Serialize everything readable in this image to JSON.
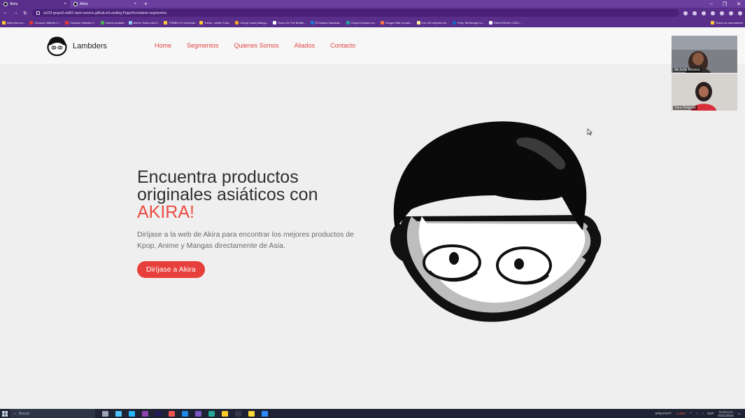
{
  "browser": {
    "tabs": [
      {
        "label": "Akira",
        "active": true
      },
      {
        "label": "Akira",
        "active": false
      }
    ],
    "url": "ai129-grupo2-wd52-open-source.github.io/Landing-Page/#container-segmentos",
    "bookmarks": [
      "https://es.mo...",
      "Corazon Valiente C...",
      "Corazon Valiente C...",
      "Nueva pestaña",
      "Anime Toriko sub E...",
      "TORBO 37 excelente",
      "Toriko - anime Torik...",
      "Candy Candy Manga...",
      "Tosos De The Beatle...",
      "El Estadio Nacional...",
      "Omiya Kyosuki por...",
      "Dragon Ball comple...",
      "Los 100 mejores de...",
      "Fairy Tail Manga Co...",
      "RADIOHEAD | DISC..."
    ],
    "bookmarks_all": "Todos los marcadores"
  },
  "nav": {
    "brand": "Lambders",
    "links": [
      "Home",
      "Segmentos",
      "Quienes Somos",
      "Aliados",
      "Contacto"
    ]
  },
  "hero": {
    "title_line1": "Encuentra productos",
    "title_line2": "originales asiáticos con",
    "title_accent": "AKIRA!",
    "description": "Diríjase a la web de Akira para encontrar los mejores productos de Kpop, Anime y Mangas directamente de Asia.",
    "cta_label": "Diríjase a Akira"
  },
  "video_call": [
    {
      "name": "Michelle Moreno"
    },
    {
      "name": "Sara Delgado"
    }
  ],
  "taskbar": {
    "search_placeholder": "Buscar",
    "stock_ticker": "SPBLPGPT",
    "stock_change": "-1.56%",
    "language": "ESP",
    "time": "10:20 p.m.",
    "date": "03/11/2024"
  },
  "colors": {
    "accent": "#e7403c",
    "browser_purple": "#5a2f8c",
    "page_bg": "#efefef"
  }
}
